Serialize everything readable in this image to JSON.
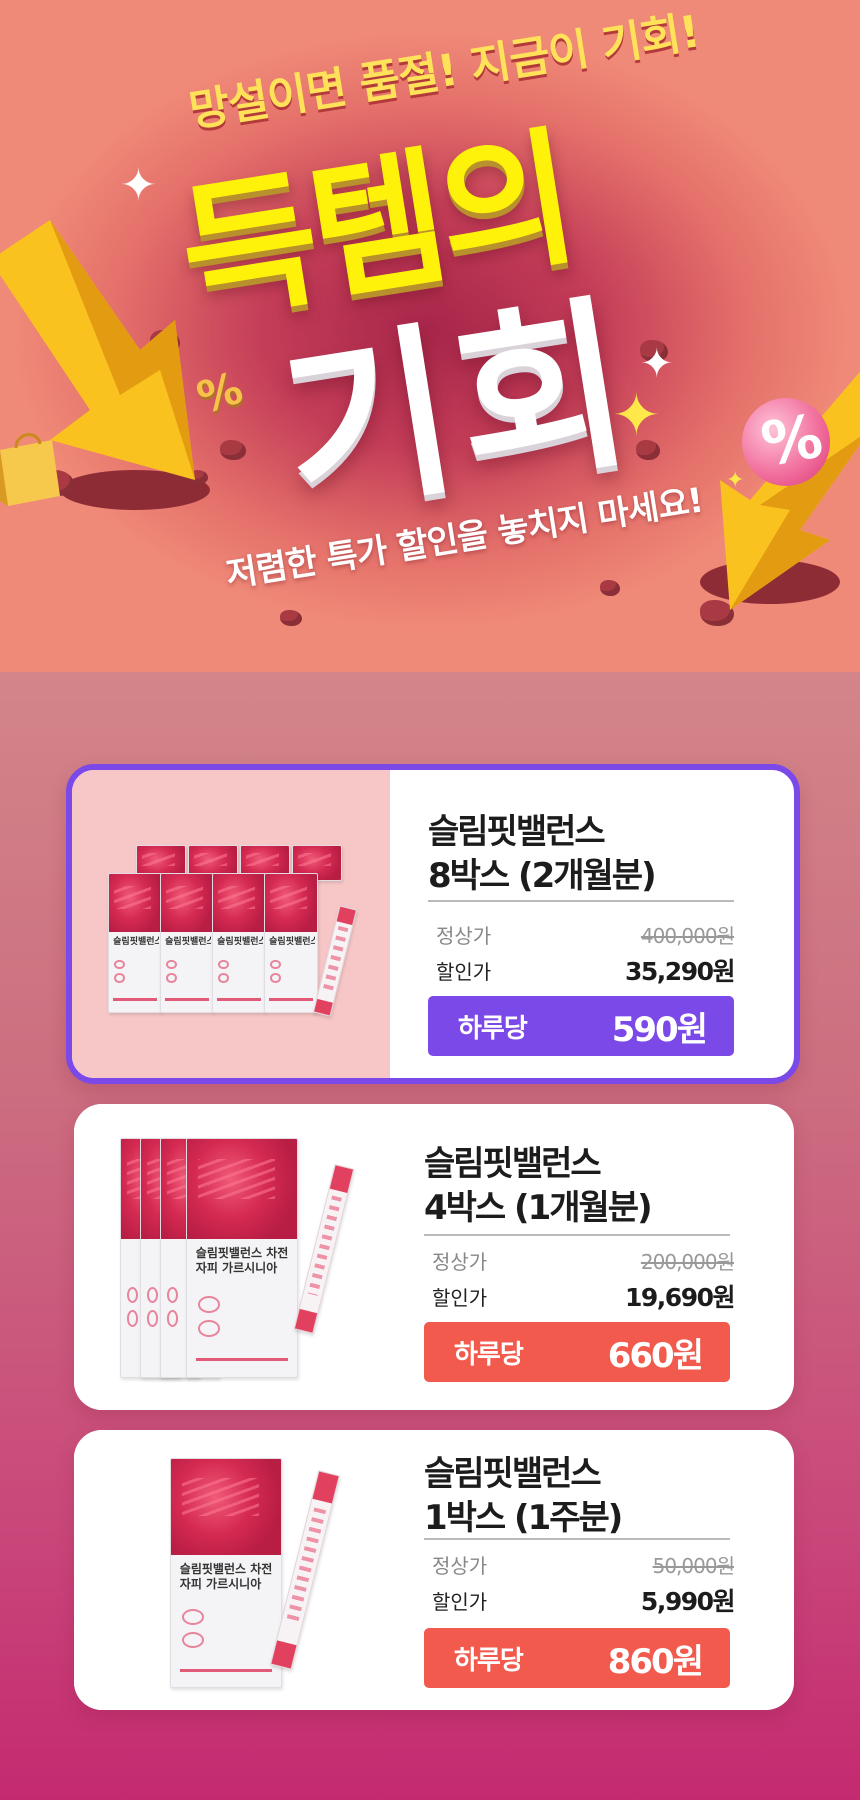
{
  "hero": {
    "subtitle_top": "망설이면 품절! 지금이 기회!",
    "title_line1": "득템의",
    "title_line2": "기회",
    "subtitle_bottom": "저렴한 특가 할인을 놓치지 마세요!",
    "percent_symbol": "%",
    "colors": {
      "title_yellow": "#fff20a",
      "bg_deep": "#a8264a",
      "bg_light": "#f08a78"
    }
  },
  "products": [
    {
      "name_line1": "슬림핏밸런스",
      "name_line2": "8박스 (2개월분)",
      "regular_label": "정상가",
      "regular_price": "400,000원",
      "sale_label": "할인가",
      "sale_price": "35,290원",
      "daily_label": "하루당",
      "daily_price": "590원",
      "box_text": "슬림핏밸런스 차전자피 가르시니아",
      "accent": "#7a49e8",
      "featured": true
    },
    {
      "name_line1": "슬림핏밸런스",
      "name_line2": "4박스 (1개월분)",
      "regular_label": "정상가",
      "regular_price": "200,000원",
      "sale_label": "할인가",
      "sale_price": "19,690원",
      "daily_label": "하루당",
      "daily_price": "660원",
      "box_text": "슬림핏밸런스 차전자피 가르시니아",
      "accent": "#f15a4d",
      "featured": false
    },
    {
      "name_line1": "슬림핏밸런스",
      "name_line2": "1박스 (1주분)",
      "regular_label": "정상가",
      "regular_price": "50,000원",
      "sale_label": "할인가",
      "sale_price": "5,990원",
      "daily_label": "하루당",
      "daily_price": "860원",
      "box_text": "슬림핏밸런스 차전자피 가르시니아",
      "accent": "#f15a4d",
      "featured": false
    }
  ]
}
